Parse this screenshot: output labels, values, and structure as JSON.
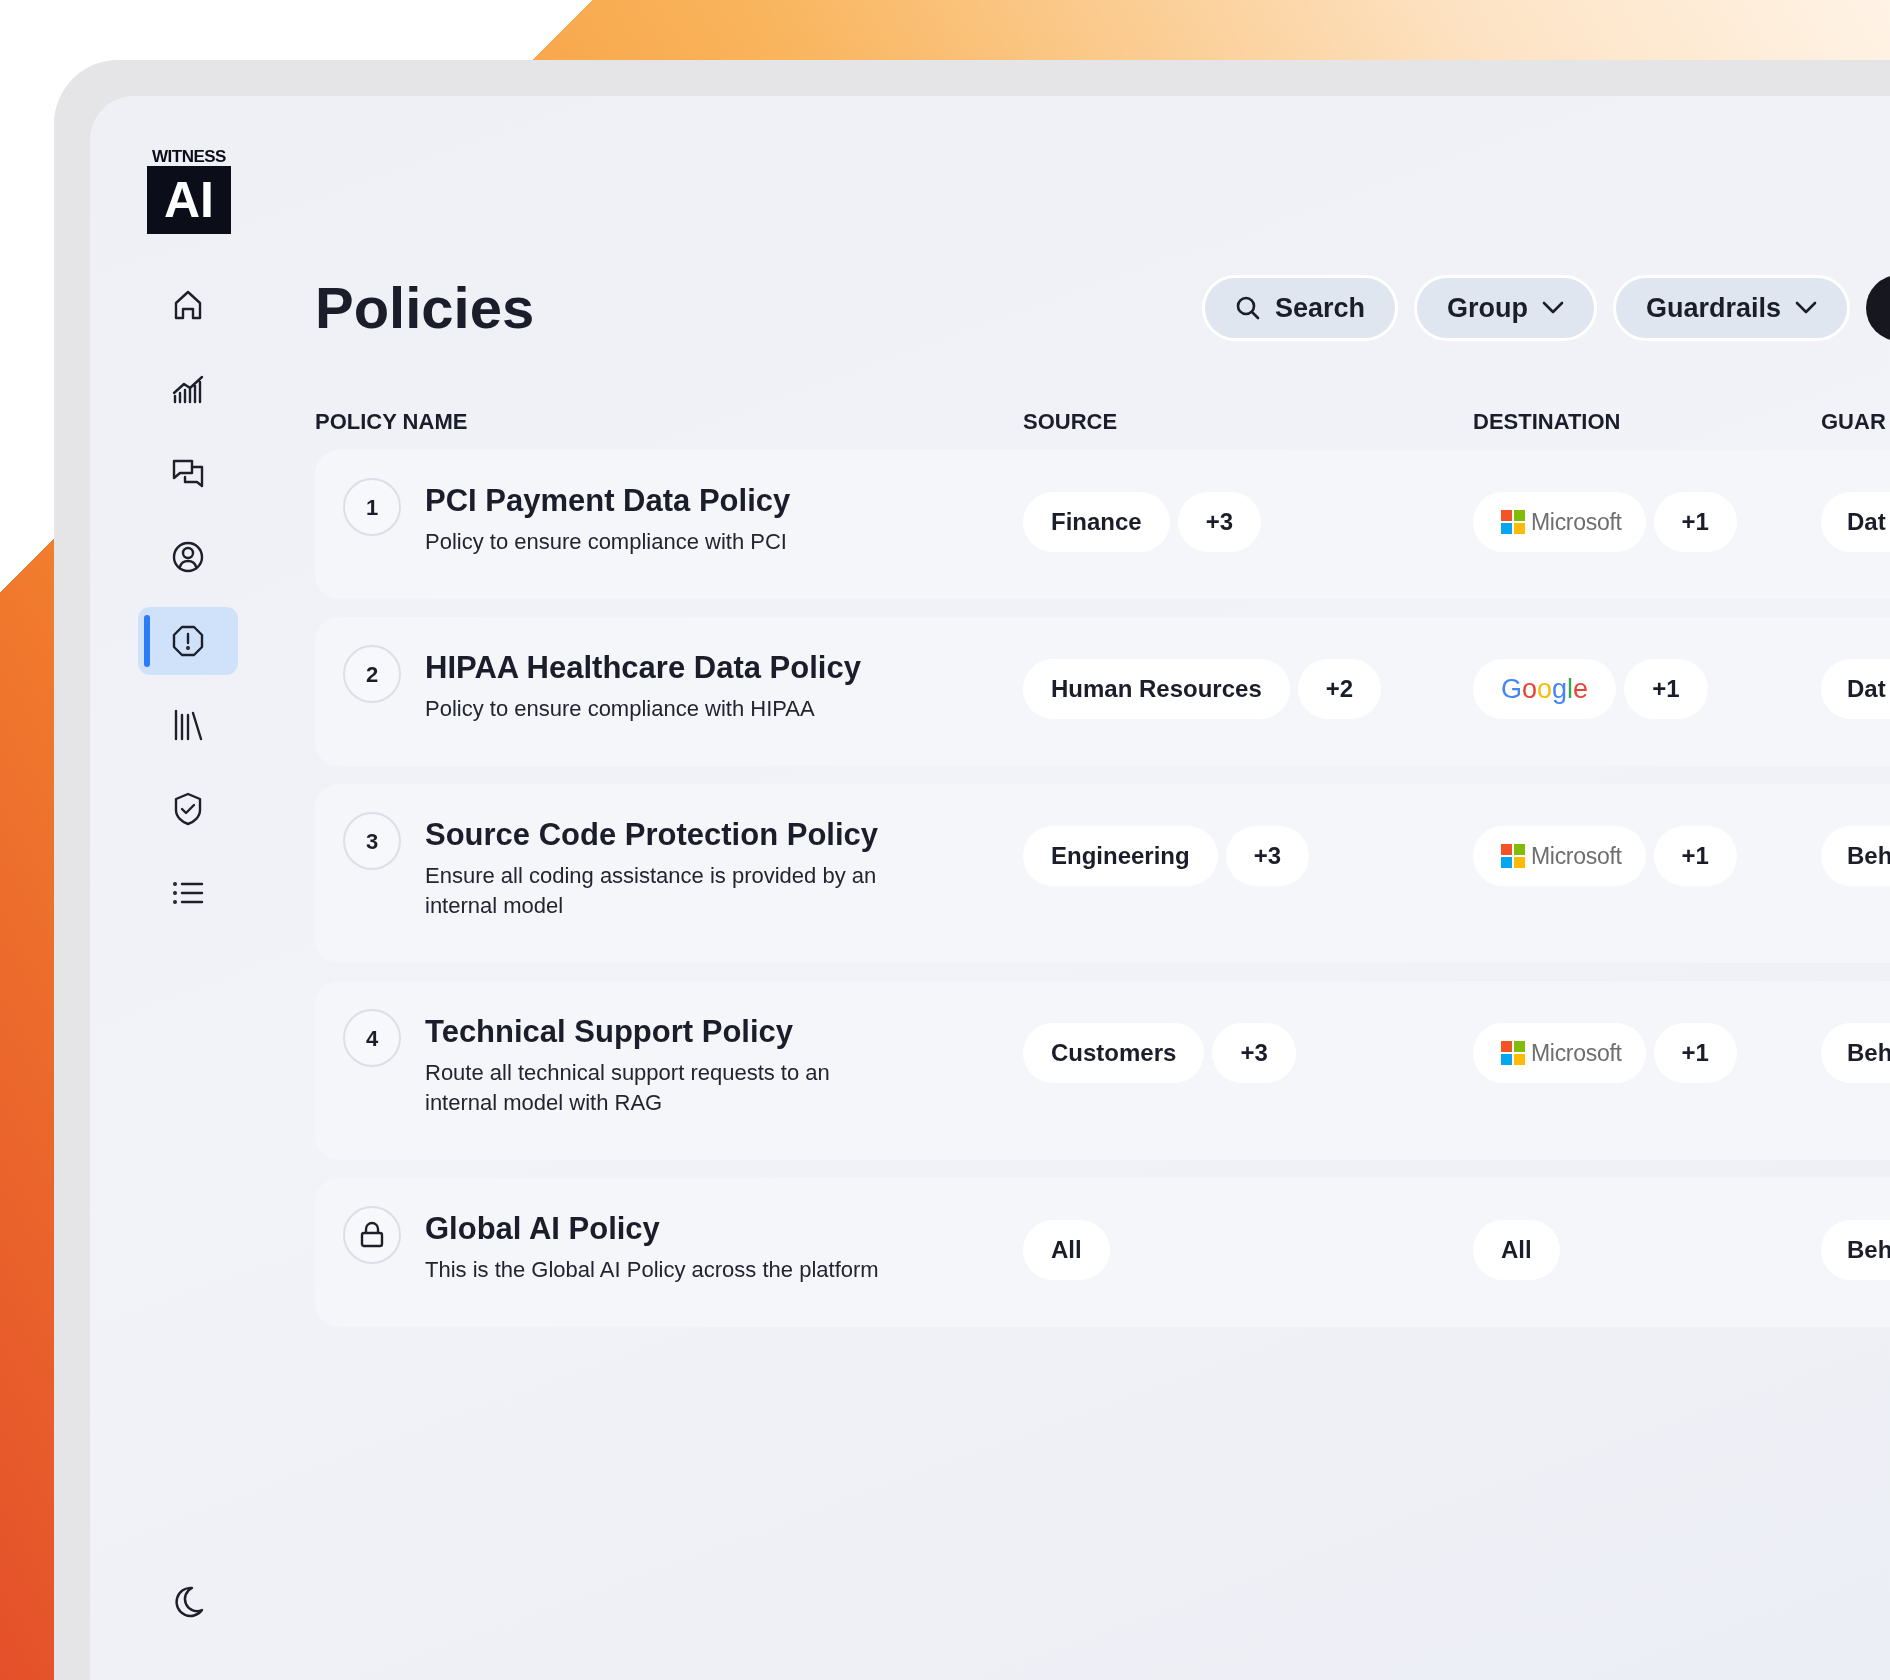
{
  "logo": {
    "top": "WITNESS",
    "mark": "AI"
  },
  "sidebar": {
    "items": [
      {
        "kind": "home",
        "selected": false
      },
      {
        "kind": "chart",
        "selected": false
      },
      {
        "kind": "chat",
        "selected": false
      },
      {
        "kind": "user",
        "selected": false
      },
      {
        "kind": "alert",
        "selected": true
      },
      {
        "kind": "library",
        "selected": false
      },
      {
        "kind": "shield",
        "selected": false
      },
      {
        "kind": "list",
        "selected": false
      }
    ],
    "theme_toggle": {
      "selected": false
    }
  },
  "page_title": "Policies",
  "toolbar": [
    {
      "kind": "search",
      "label": "Search"
    },
    {
      "kind": "dropdown",
      "label": "Group"
    },
    {
      "kind": "dropdown",
      "label": "Guardrails"
    }
  ],
  "table": {
    "columns": [
      "POLICY NAME",
      "SOURCE",
      "DESTINATION",
      "GUAR"
    ],
    "rows": [
      {
        "marker": {
          "kind": "number",
          "label": "1"
        },
        "name": "PCI Payment Data Policy",
        "description": "Policy to ensure compliance with PCI",
        "source": [
          "Finance",
          "+3"
        ],
        "destination": [
          {
            "kind": "microsoft",
            "label": "Microsoft"
          },
          {
            "kind": "text",
            "label": "+1"
          }
        ],
        "guardrails": [
          "Dat"
        ]
      },
      {
        "marker": {
          "kind": "number",
          "label": "2"
        },
        "name": "HIPAA Healthcare Data Policy",
        "description": "Policy to ensure compliance with HIPAA",
        "source": [
          "Human Resources",
          "+2"
        ],
        "destination": [
          {
            "kind": "google",
            "label": "Google"
          },
          {
            "kind": "text",
            "label": "+1"
          }
        ],
        "guardrails": [
          "Dat"
        ]
      },
      {
        "marker": {
          "kind": "number",
          "label": "3"
        },
        "name": "Source Code Protection Policy",
        "description": "Ensure all coding assistance is provided by an internal model",
        "source": [
          "Engineering",
          "+3"
        ],
        "destination": [
          {
            "kind": "microsoft",
            "label": "Microsoft"
          },
          {
            "kind": "text",
            "label": "+1"
          }
        ],
        "guardrails": [
          "Beh"
        ]
      },
      {
        "marker": {
          "kind": "number",
          "label": "4"
        },
        "name": "Technical Support Policy",
        "description": "Route all technical support requests to an internal model with RAG",
        "source": [
          "Customers",
          "+3"
        ],
        "destination": [
          {
            "kind": "microsoft",
            "label": "Microsoft"
          },
          {
            "kind": "text",
            "label": "+1"
          }
        ],
        "guardrails": [
          "Beh"
        ]
      },
      {
        "marker": {
          "kind": "lock"
        },
        "name": "Global AI Policy",
        "description": "This is the Global AI Policy across the platform",
        "source": [
          "All"
        ],
        "destination": [
          {
            "kind": "text",
            "label": "All"
          }
        ],
        "guardrails": [
          "Beh"
        ]
      }
    ]
  }
}
